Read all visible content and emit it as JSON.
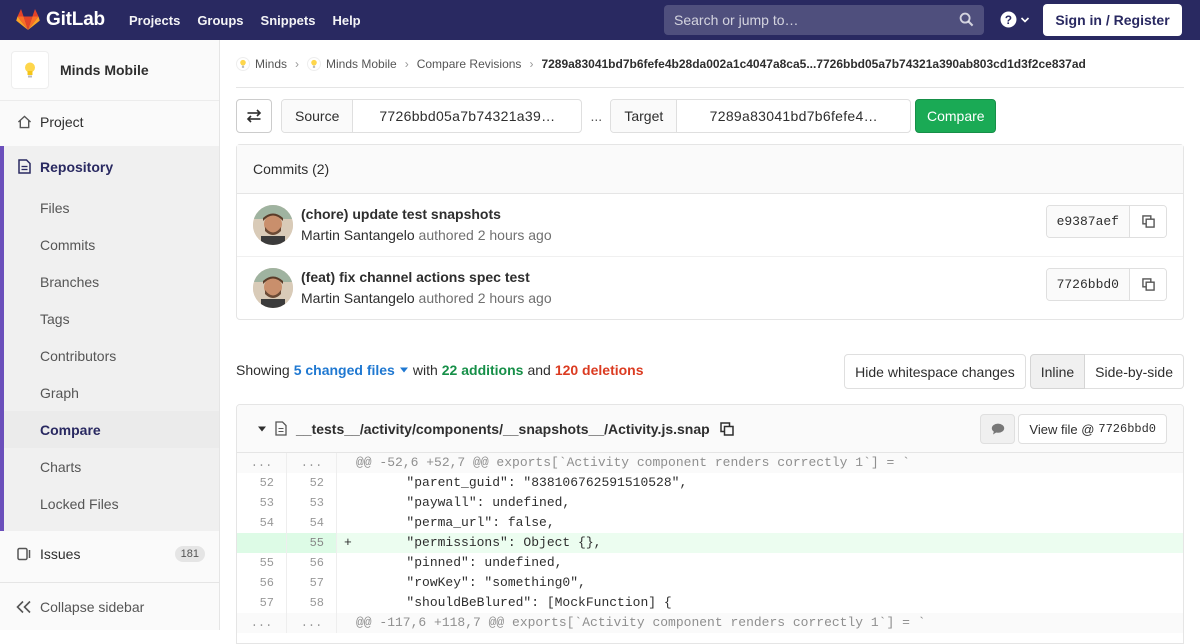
{
  "nav": {
    "brand": "GitLab",
    "links": [
      "Projects",
      "Groups",
      "Snippets",
      "Help"
    ],
    "search_placeholder": "Search or jump to…",
    "sign_in": "Sign in / Register"
  },
  "sidebar": {
    "project_name": "Minds Mobile",
    "project": "Project",
    "repository": "Repository",
    "repo_items": [
      "Files",
      "Commits",
      "Branches",
      "Tags",
      "Contributors",
      "Graph",
      "Compare",
      "Charts",
      "Locked Files"
    ],
    "active_item": "Compare",
    "issues": "Issues",
    "issues_count": "181",
    "collapse": "Collapse sidebar"
  },
  "breadcrumb": {
    "items": [
      "Minds",
      "Minds Mobile",
      "Compare Revisions"
    ],
    "current": "7289a83041bd7b6fefe4b28da002a1c4047a8ca5...7726bbd05a7b74321a390ab803cd1d3f2ce837ad"
  },
  "compare": {
    "source_label": "Source",
    "source_value": "7726bbd05a7b74321a39…",
    "dots": "...",
    "target_label": "Target",
    "target_value": "7289a83041bd7b6fefe4…",
    "button": "Compare"
  },
  "commits": {
    "header": "Commits (2)",
    "rows": [
      {
        "title": "(chore) update test snapshots",
        "author": "Martin Santangelo",
        "meta": "authored 2 hours ago",
        "sha": "e9387aef"
      },
      {
        "title": "(feat) fix channel actions spec test",
        "author": "Martin Santangelo",
        "meta": "authored 2 hours ago",
        "sha": "7726bbd0"
      }
    ]
  },
  "stats": {
    "showing": "Showing",
    "files": "5 changed files",
    "with": "with",
    "additions": "22 additions",
    "and": "and",
    "deletions": "120 deletions"
  },
  "diff_options": {
    "whitespace": "Hide whitespace changes",
    "inline": "Inline",
    "side_by_side": "Side-by-side"
  },
  "file": {
    "path": "__tests__/activity/components/__snapshots__/Activity.js.snap",
    "view_file": "View file @",
    "view_sha": "7726bbd0",
    "lines": [
      {
        "type": "match",
        "old": "...",
        "new": "...",
        "code": "@@ -52,6 +52,7 @@ exports[`Activity component renders correctly 1`] = `"
      },
      {
        "type": "context",
        "old": "52",
        "new": "52",
        "code": "        \"parent_guid\": \"838106762591510528\","
      },
      {
        "type": "context",
        "old": "53",
        "new": "53",
        "code": "        \"paywall\": undefined,"
      },
      {
        "type": "context",
        "old": "54",
        "new": "54",
        "code": "        \"perma_url\": false,"
      },
      {
        "type": "added",
        "old": "",
        "new": "55",
        "code": "+       \"permissions\": Object {},"
      },
      {
        "type": "context",
        "old": "55",
        "new": "56",
        "code": "        \"pinned\": undefined,"
      },
      {
        "type": "context",
        "old": "56",
        "new": "57",
        "code": "        \"rowKey\": \"something0\","
      },
      {
        "type": "context",
        "old": "57",
        "new": "58",
        "code": "        \"shouldBeBlured\": [MockFunction] {"
      },
      {
        "type": "match",
        "old": "...",
        "new": "...",
        "code": "@@ -117,6 +118,7 @@ exports[`Activity component renders correctly 1`] = `"
      }
    ]
  },
  "colors": {
    "nav_bg": "#292961",
    "accent_green": "#1aaa55",
    "link_blue": "#1f78d1",
    "addition": "#168f48",
    "deletion": "#db3b21"
  }
}
